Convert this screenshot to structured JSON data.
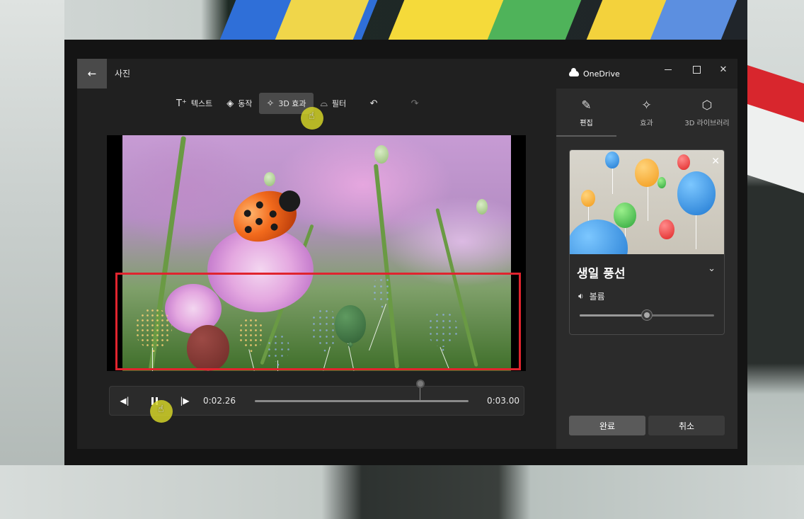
{
  "window": {
    "app_title": "사진",
    "onedrive_label": "OneDrive"
  },
  "toolbar": {
    "text_label": "텍스트",
    "motion_label": "동작",
    "effects3d_label": "3D 효과",
    "filter_label": "필터"
  },
  "playback": {
    "current_time": "0:02.26",
    "total_time": "0:03.00"
  },
  "panel": {
    "tabs": [
      {
        "label": "편집",
        "icon": "pencil-icon",
        "active": true
      },
      {
        "label": "효과",
        "icon": "sparkle-icon",
        "active": false
      },
      {
        "label": "3D 라이브러리",
        "icon": "cube-icon",
        "active": false
      }
    ],
    "effect_card": {
      "title": "생일 풍선",
      "volume_label": "볼륨",
      "volume_level": 0.5
    },
    "done_label": "완료",
    "cancel_label": "취소"
  },
  "colors": {
    "accent_selection": "#e0242e",
    "cursor_highlight": "#d2d228"
  }
}
